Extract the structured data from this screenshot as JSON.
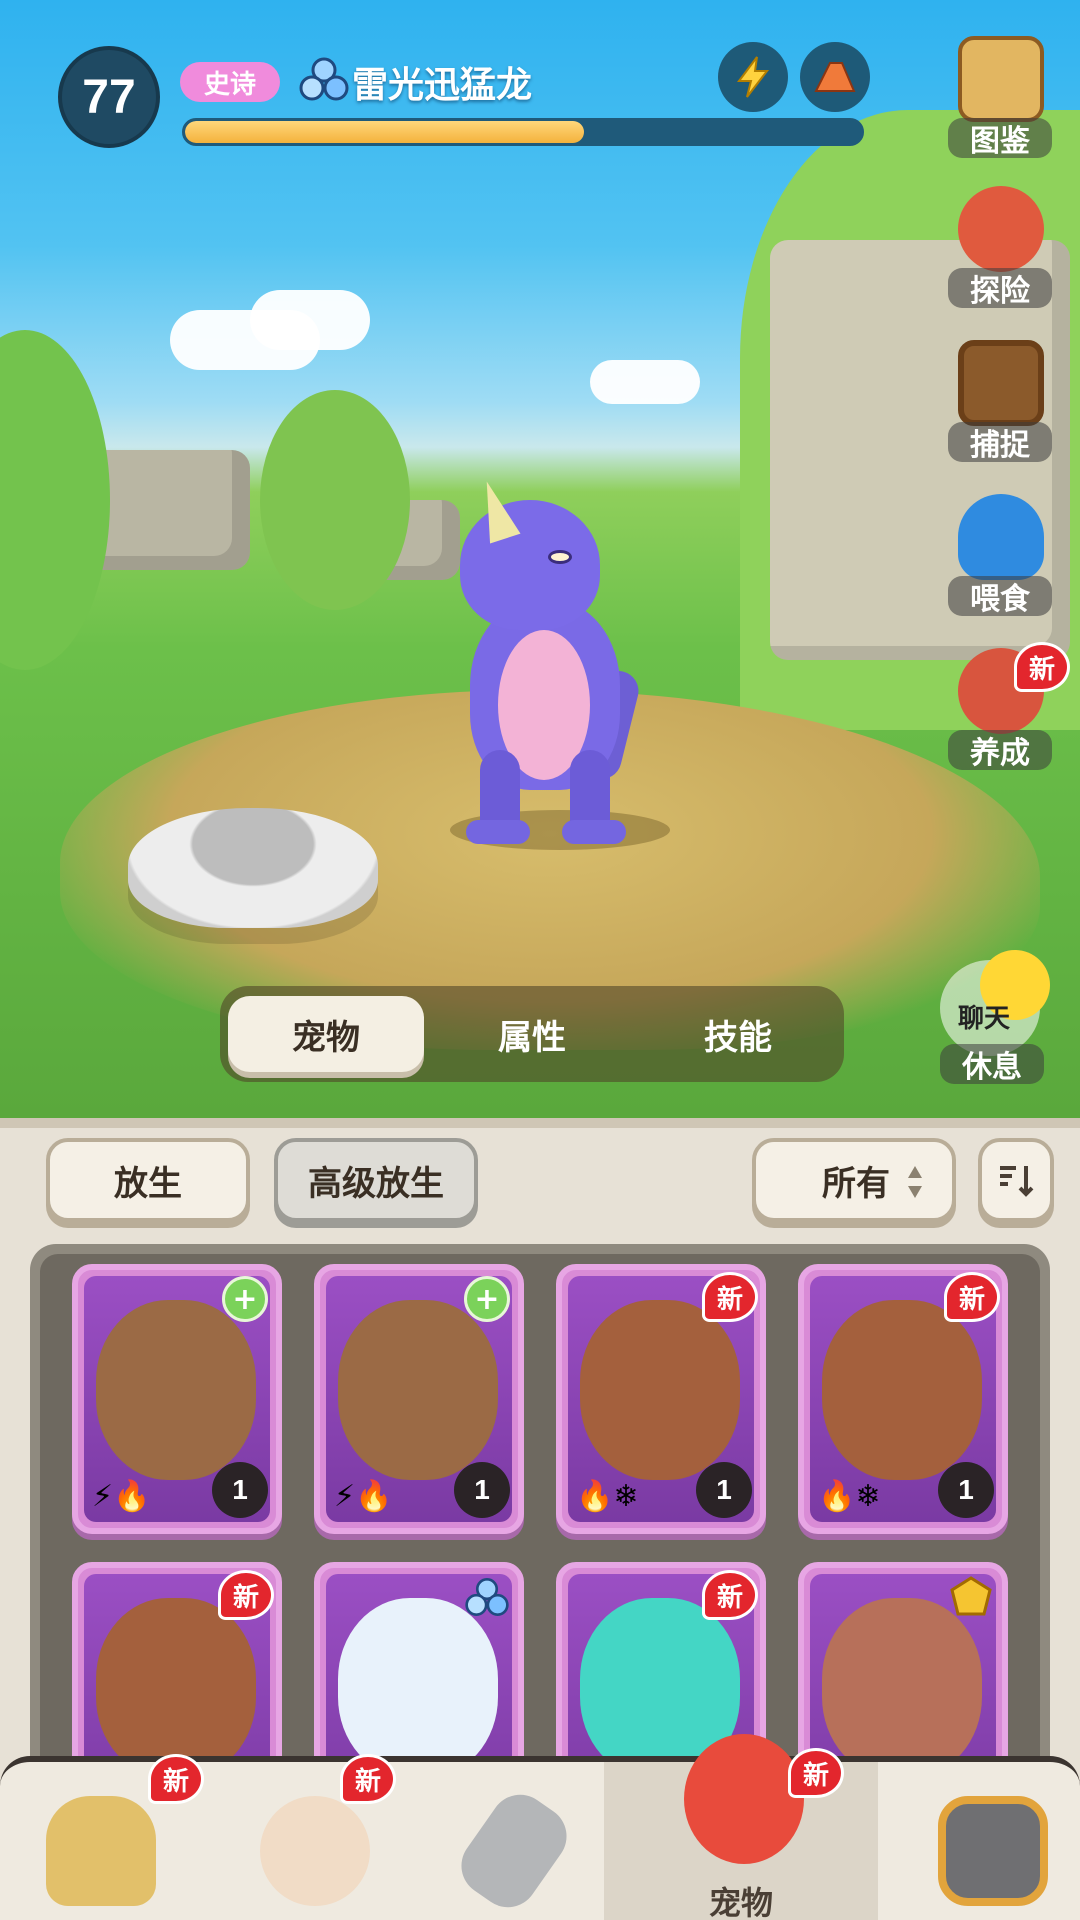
{
  "hud": {
    "level": "77",
    "rarity": "史诗",
    "pet_name": "雷光迅猛龙",
    "hp_fraction": 0.59,
    "bolt_icon": "lightning-icon",
    "mountain_icon": "mountain-icon"
  },
  "side_menu": {
    "items": [
      {
        "label": "图鉴",
        "icon": "dinosaur-book-icon",
        "has_new": false
      },
      {
        "label": "探险",
        "icon": "adventure-icon",
        "has_new": false
      },
      {
        "label": "捕捉",
        "icon": "cage-icon",
        "has_new": false
      },
      {
        "label": "喂食",
        "icon": "feed-icon",
        "has_new": false
      },
      {
        "label": "养成",
        "icon": "train-icon",
        "has_new": true
      }
    ],
    "new_label": "新"
  },
  "tabs": [
    {
      "label": "宠物",
      "active": true
    },
    {
      "label": "属性",
      "active": false
    },
    {
      "label": "技能",
      "active": false
    }
  ],
  "chat": {
    "label": "聊天",
    "rest_label": "休息"
  },
  "toolbar": {
    "release": "放生",
    "advanced_release": "高级放生",
    "filter": "所有",
    "sort_icon": "sort-icon"
  },
  "cards": [
    {
      "kind": "rhino",
      "level": "1",
      "badge": "heart",
      "elements": "⚡🔥"
    },
    {
      "kind": "rhino",
      "level": "1",
      "badge": "heart",
      "elements": "⚡🔥"
    },
    {
      "kind": "bear",
      "level": "1",
      "badge": "new",
      "elements": "🔥❄"
    },
    {
      "kind": "bear",
      "level": "1",
      "badge": "new",
      "elements": "🔥❄"
    },
    {
      "kind": "bear",
      "level": "",
      "badge": "new",
      "elements": ""
    },
    {
      "kind": "wolf",
      "level": "",
      "badge": "type",
      "elements": ""
    },
    {
      "kind": "mantis",
      "level": "",
      "badge": "new",
      "elements": ""
    },
    {
      "kind": "ram",
      "level": "",
      "badge": "gold",
      "elements": ""
    }
  ],
  "new_label": "新",
  "bottom_nav": [
    {
      "label": "",
      "icon": "viking-icon",
      "has_new": true,
      "active": false
    },
    {
      "label": "",
      "icon": "hero-icon",
      "has_new": true,
      "active": false
    },
    {
      "label": "",
      "icon": "sword-icon",
      "has_new": false,
      "active": false
    },
    {
      "label": "宠物",
      "icon": "pet-icon",
      "has_new": true,
      "active": true
    },
    {
      "label": "",
      "icon": "portal-icon",
      "has_new": false,
      "active": false
    }
  ],
  "colors": {
    "sky": "#2fb2ef",
    "grass": "#6cc04a",
    "card": "#d98bd6",
    "rarity": "#f08bdc",
    "hp": "#f4b23c",
    "new_badge": "#e3262d"
  }
}
